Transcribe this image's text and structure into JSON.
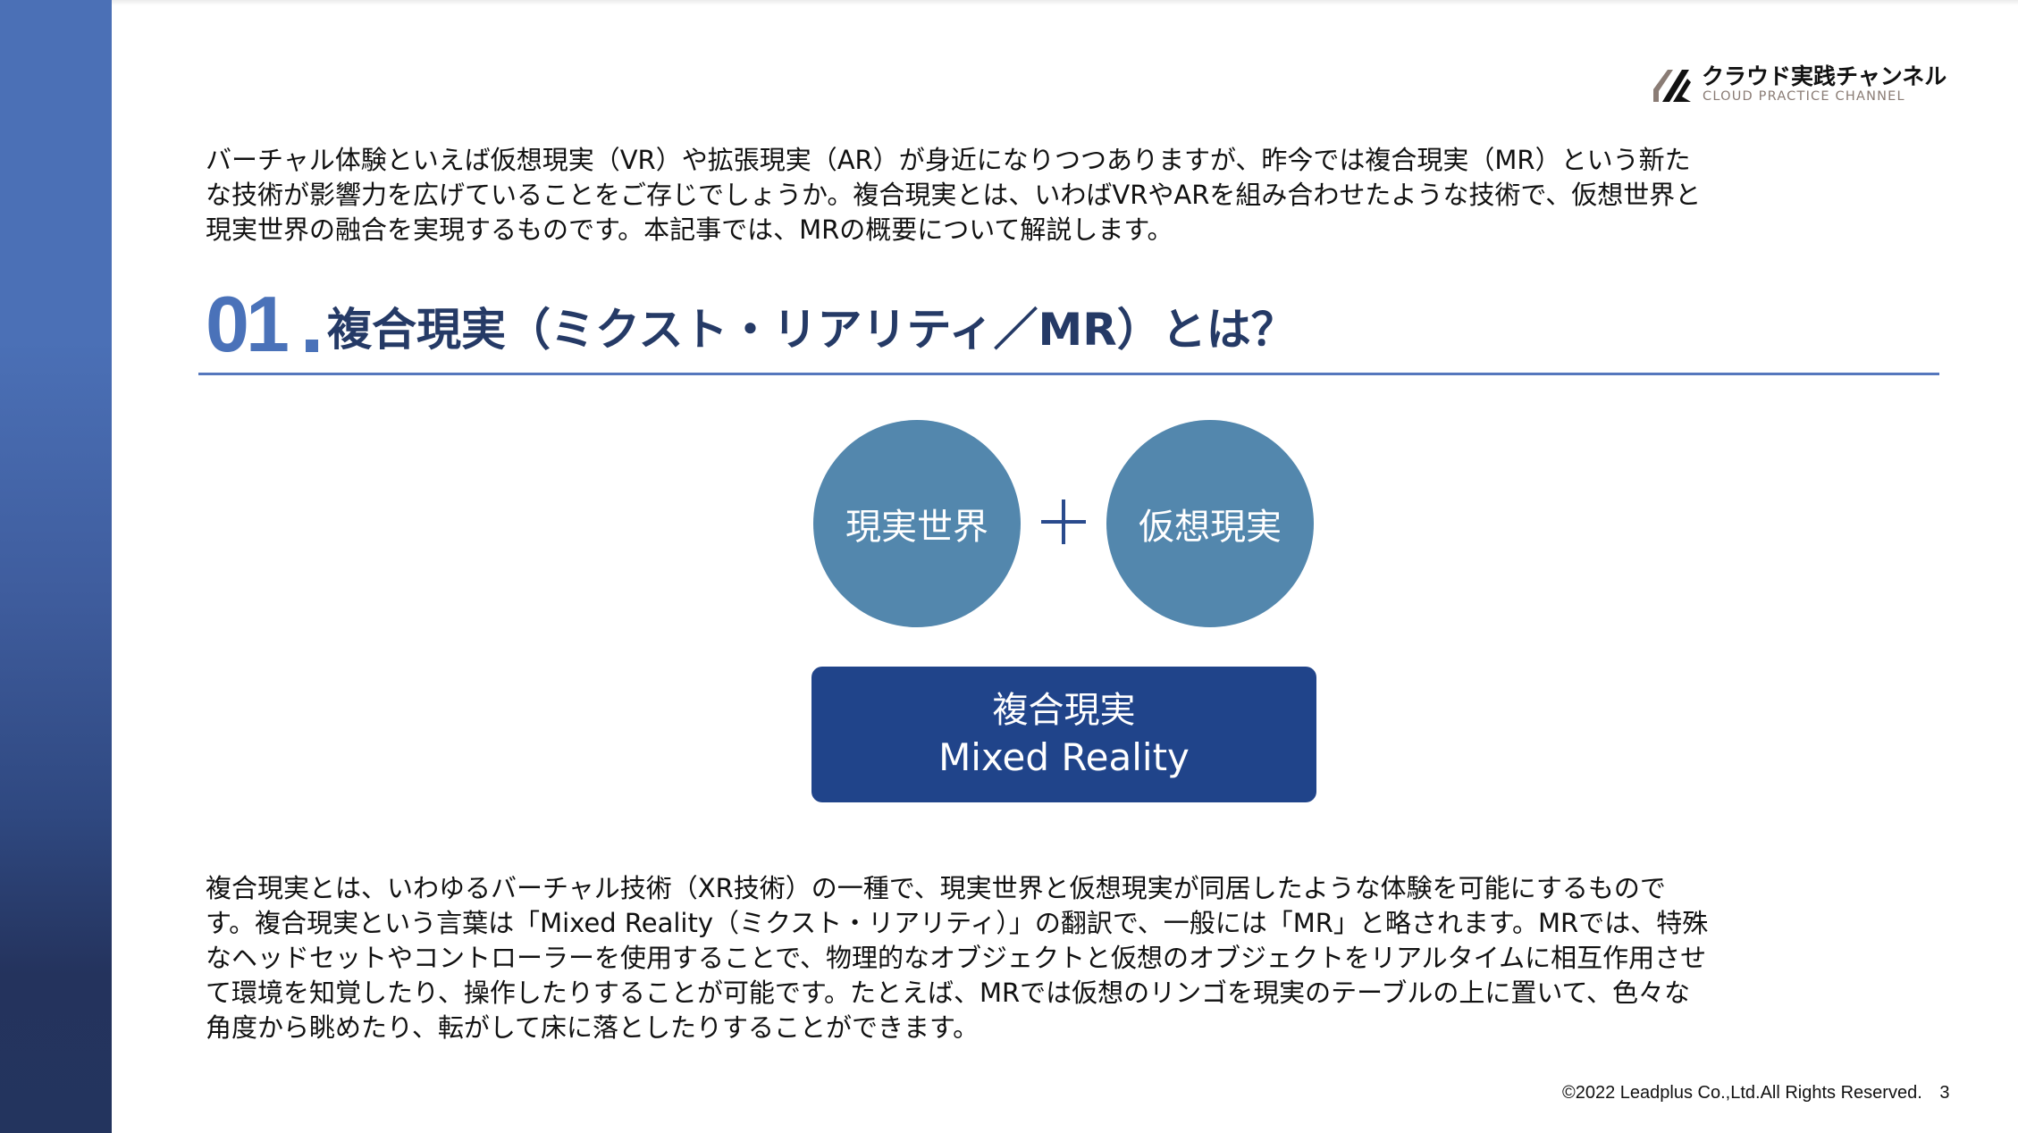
{
  "brand": {
    "logo_icon": "stripes-logo-icon",
    "name_jp": "クラウド実践チャンネル",
    "name_en": "CLOUD PRACTICE CHANNEL",
    "colors": {
      "mark_dark": "#111111",
      "mark_taupe": "#8a7c75"
    }
  },
  "intro": {
    "lines": [
      "バーチャル体験といえば仮想現実（VR）や拡張現実（AR）が身近になりつつありますが、昨今では複合現実（MR）という新た",
      "な技術が影響力を広げていることをご存じでしょうか。複合現実とは、いわばVRやARを組み合わせたような技術で、仮想世界と",
      "現実世界の融合を実現するものです。本記事では、MRの概要について解説します。"
    ]
  },
  "section": {
    "number": "01",
    "title": "複合現実（ミクスト・リアリティ／MR）とは？"
  },
  "diagram": {
    "left_circle": "現実世界",
    "operator": "plus-icon",
    "right_circle": "仮想現実",
    "result_jp": "複合現実",
    "result_en": "Mixed Reality",
    "colors": {
      "circle": "#5387ad",
      "result_box": "#20448a",
      "plus": "#2a4b8d"
    }
  },
  "body": {
    "lines": [
      "複合現実とは、いわゆるバーチャル技術（XR技術）の一種で、現実世界と仮想現実が同居したような体験を可能にするもので",
      "す。複合現実という言葉は「Mixed Reality（ミクスト・リアリティ）」の翻訳で、一般には「MR」と略されます。MRでは、特殊",
      "なヘッドセットやコントローラーを使用することで、物理的なオブジェクトと仮想のオブジェクトをリアルタイムに相互作用させ",
      "て環境を知覚したり、操作したりすることが可能です。たとえば、MRでは仮想のリンゴを現実のテーブルの上に置いて、色々な",
      "角度から眺めたり、転がして床に落としたりすることができます。"
    ]
  },
  "footer": {
    "copyright": "©2022 Leadplus Co.,Ltd.All Rights Reserved.",
    "page_number": "3"
  },
  "theme": {
    "accent": "#4a72b9",
    "heading_text": "#253a66",
    "rule": "#5577bd",
    "side_band_top": "#4b70b6",
    "side_band_bottom": "#23345e"
  }
}
